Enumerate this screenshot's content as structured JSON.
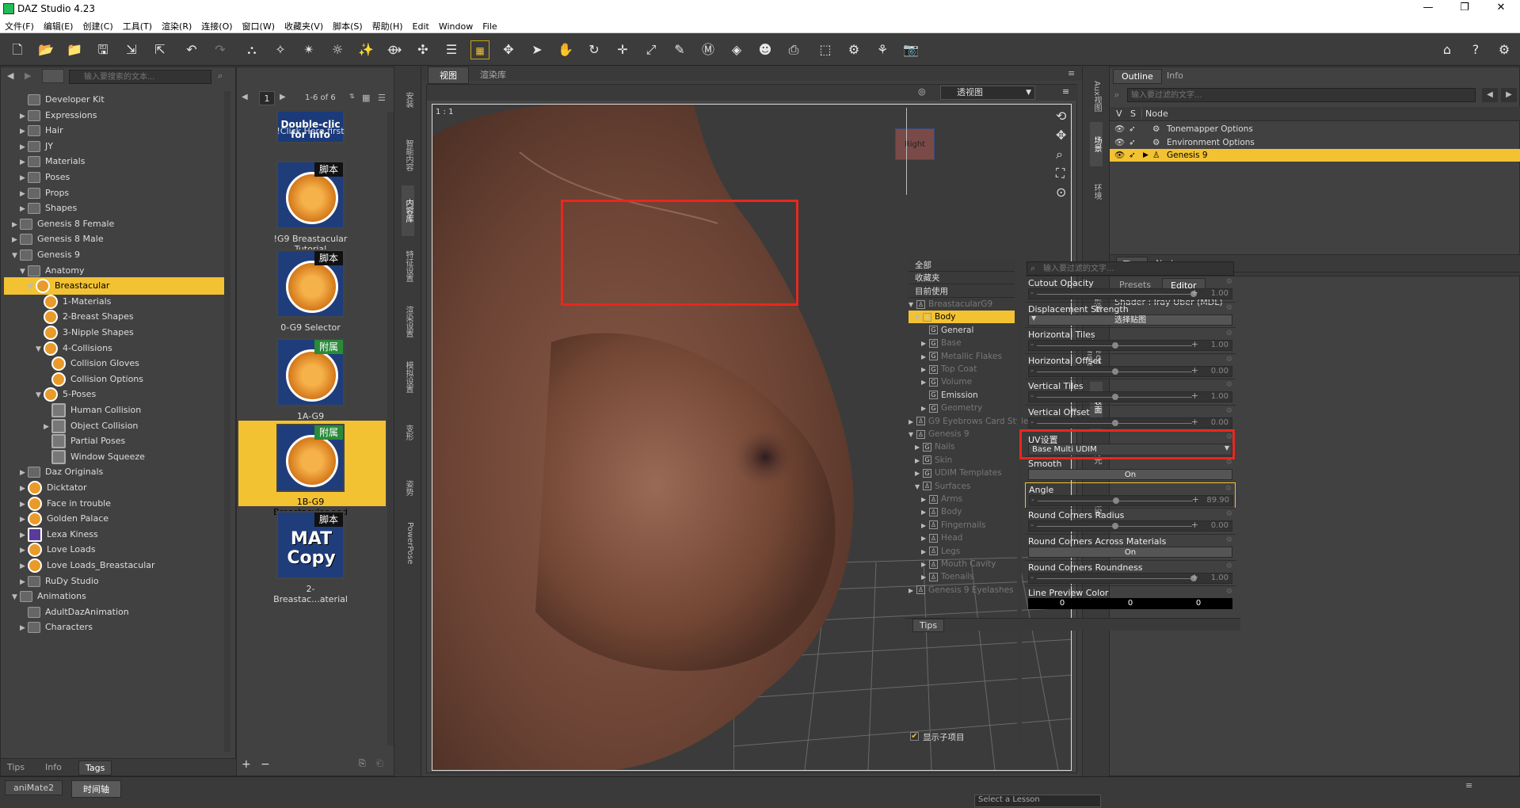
{
  "window": {
    "title": "DAZ Studio 4.23",
    "min": "—",
    "restore": "❐",
    "close": "✕"
  },
  "menu": [
    "文件(F)",
    "编辑(E)",
    "创建(C)",
    "工具(T)",
    "渲染(R)",
    "连接(O)",
    "窗口(W)",
    "收藏夹(V)",
    "脚本(S)",
    "帮助(H)",
    "Edit",
    "Window",
    "File"
  ],
  "content_library": {
    "search_placeholder": "输入要搜索的文本...",
    "tree": [
      {
        "label": "Developer Kit",
        "level": 2,
        "arrow": "",
        "icon": "folder"
      },
      {
        "label": "Expressions",
        "level": 2,
        "arrow": "▶",
        "icon": "folder"
      },
      {
        "label": "Hair",
        "level": 2,
        "arrow": "▶",
        "icon": "folder"
      },
      {
        "label": "JY",
        "level": 2,
        "arrow": "▶",
        "icon": "folder"
      },
      {
        "label": "Materials",
        "level": 2,
        "arrow": "▶",
        "icon": "folder"
      },
      {
        "label": "Poses",
        "level": 2,
        "arrow": "▶",
        "icon": "folder"
      },
      {
        "label": "Props",
        "level": 2,
        "arrow": "▶",
        "icon": "folder"
      },
      {
        "label": "Shapes",
        "level": 2,
        "arrow": "▶",
        "icon": "folder"
      },
      {
        "label": "Genesis 8 Female",
        "level": 1,
        "arrow": "▶",
        "icon": "folder"
      },
      {
        "label": "Genesis 8 Male",
        "level": 1,
        "arrow": "▶",
        "icon": "folder"
      },
      {
        "label": "Genesis 9",
        "level": 1,
        "arrow": "▼",
        "icon": "folder"
      },
      {
        "label": "Anatomy",
        "level": 2,
        "arrow": "▼",
        "icon": "folder"
      },
      {
        "label": "Breastacular",
        "level": 3,
        "arrow": "▼",
        "icon": "orange",
        "selected": true
      },
      {
        "label": "1-Materials",
        "level": 4,
        "arrow": "",
        "icon": "orange"
      },
      {
        "label": "2-Breast Shapes",
        "level": 4,
        "arrow": "",
        "icon": "orange"
      },
      {
        "label": "3-Nipple Shapes",
        "level": 4,
        "arrow": "",
        "icon": "orange"
      },
      {
        "label": "4-Collisions",
        "level": 4,
        "arrow": "▼",
        "icon": "orange"
      },
      {
        "label": "Collision Gloves",
        "level": 5,
        "arrow": "",
        "icon": "orange"
      },
      {
        "label": "Collision Options",
        "level": 5,
        "arrow": "",
        "icon": "orange"
      },
      {
        "label": "5-Poses",
        "level": 4,
        "arrow": "▼",
        "icon": "orange"
      },
      {
        "label": "Human Collision",
        "level": 5,
        "arrow": "",
        "icon": "grey"
      },
      {
        "label": "Object Collision",
        "level": 5,
        "arrow": "▶",
        "icon": "grey"
      },
      {
        "label": "Partial Poses",
        "level": 5,
        "arrow": "",
        "icon": "grey"
      },
      {
        "label": "Window Squeeze",
        "level": 5,
        "arrow": "",
        "icon": "grey"
      },
      {
        "label": "Daz Originals",
        "level": 2,
        "arrow": "▶",
        "icon": "folder"
      },
      {
        "label": "Dicktator",
        "level": 2,
        "arrow": "▶",
        "icon": "orange"
      },
      {
        "label": "Face in trouble",
        "level": 2,
        "arrow": "▶",
        "icon": "orange"
      },
      {
        "label": "Golden Palace",
        "level": 2,
        "arrow": "▶",
        "icon": "orange"
      },
      {
        "label": "Lexa Kiness",
        "level": 2,
        "arrow": "▶",
        "icon": "purple"
      },
      {
        "label": "Love Loads",
        "level": 2,
        "arrow": "▶",
        "icon": "orange"
      },
      {
        "label": "Love Loads_Breastacular",
        "level": 2,
        "arrow": "▶",
        "icon": "orange"
      },
      {
        "label": "RuDy Studio",
        "level": 2,
        "arrow": "▶",
        "icon": "folder"
      },
      {
        "label": "Animations",
        "level": 1,
        "arrow": "▼",
        "icon": "folder"
      },
      {
        "label": "AdultDazAnimation",
        "level": 2,
        "arrow": "",
        "icon": "folder"
      },
      {
        "label": "Characters",
        "level": 2,
        "arrow": "▶",
        "icon": "folder"
      }
    ],
    "bottom_tabs": [
      "Tips",
      "Info",
      "Tags"
    ],
    "active_bottom_tab": "Tags"
  },
  "thumbnails": {
    "page": "1",
    "range": "1-6 of 6",
    "items": [
      {
        "caption": "!Click Here first",
        "tag": "",
        "overlay": "Double-clic for info"
      },
      {
        "caption": "!G9 Breastacular Tutorial",
        "tag": "脚本",
        "overlay": ""
      },
      {
        "caption": "0-G9 Selector",
        "tag": "脚本",
        "overlay": ""
      },
      {
        "caption": "1A-G9 Breastacular Graft",
        "tag": "附属",
        "overlay": ""
      },
      {
        "caption": "1B-G9 Breastacular and Gloves",
        "tag": "附属",
        "overlay": ""
      },
      {
        "caption": "2-Breastac...aterial",
        "tag": "脚本",
        "overlay": "MAT Copy"
      }
    ]
  },
  "left_side_tabs": [
    "安装",
    "智能内容",
    "内容库",
    "特征设置",
    "渲染设置",
    "模拟设置",
    "变形",
    "姿势",
    "PowerPose"
  ],
  "viewport": {
    "tabs": [
      "视图",
      "渲染库"
    ],
    "ratio": "1 : 1",
    "camera": "透视图",
    "cube_label": "Right"
  },
  "right_side_tabs_top": [
    "Aux视图",
    "场景",
    "环境"
  ],
  "right_side_tabs_bottom": [
    "形状",
    "Face Transfer",
    "表面",
    "灯光",
    "渲染"
  ],
  "scene": {
    "tabs": [
      "Outline",
      "Info"
    ],
    "filter_placeholder": "输入要过滤的文字...",
    "headers": {
      "v": "V",
      "s": "S",
      "node": "Node"
    },
    "nodes": [
      {
        "label": "Tonemapper Options",
        "selected": false
      },
      {
        "label": "Environment Options",
        "selected": false
      },
      {
        "label": "Genesis 9",
        "selected": true
      }
    ],
    "bottom_tabs": [
      "Tips",
      "Node"
    ]
  },
  "surfaces": {
    "tabs": [
      "Presets",
      "Editor"
    ],
    "active_tab": "Editor",
    "shader": "Shader : Iray Uber (MDL)",
    "filter_placeholder": "输入要过滤的文字...",
    "groups": [
      "全部",
      "收藏夹",
      "目前使用"
    ],
    "layers": [
      {
        "label": "BreastacularG9",
        "indent": 0,
        "arrow": "▼",
        "dim": true,
        "type": "fig"
      },
      {
        "label": "Body",
        "indent": 1,
        "arrow": "▼",
        "dim": false,
        "type": "fig",
        "selected": true
      },
      {
        "label": "General",
        "indent": 2,
        "arrow": "",
        "dim": false,
        "type": "G"
      },
      {
        "label": "Base",
        "indent": 2,
        "arrow": "▶",
        "dim": true,
        "type": "G"
      },
      {
        "label": "Metallic Flakes",
        "indent": 2,
        "arrow": "▶",
        "dim": true,
        "type": "G"
      },
      {
        "label": "Top Coat",
        "indent": 2,
        "arrow": "▶",
        "dim": true,
        "type": "G"
      },
      {
        "label": "Volume",
        "indent": 2,
        "arrow": "▶",
        "dim": true,
        "type": "G"
      },
      {
        "label": "Emission",
        "indent": 2,
        "arrow": "",
        "dim": false,
        "type": "G"
      },
      {
        "label": "Geometry",
        "indent": 2,
        "arrow": "▶",
        "dim": true,
        "type": "G"
      },
      {
        "label": "G9 Eyebrows Card Style...",
        "indent": 0,
        "arrow": "▶",
        "dim": true,
        "type": "fig"
      },
      {
        "label": "Genesis 9",
        "indent": 0,
        "arrow": "▼",
        "dim": true,
        "type": "fig"
      },
      {
        "label": "Nails",
        "indent": 1,
        "arrow": "▶",
        "dim": true,
        "type": "G"
      },
      {
        "label": "Skin",
        "indent": 1,
        "arrow": "▶",
        "dim": true,
        "type": "G"
      },
      {
        "label": "UDIM Templates",
        "indent": 1,
        "arrow": "▶",
        "dim": true,
        "type": "G"
      },
      {
        "label": "Surfaces",
        "indent": 1,
        "arrow": "▼",
        "dim": true,
        "type": "fig"
      },
      {
        "label": "Arms",
        "indent": 2,
        "arrow": "▶",
        "dim": true,
        "type": "fig"
      },
      {
        "label": "Body",
        "indent": 2,
        "arrow": "▶",
        "dim": true,
        "type": "fig"
      },
      {
        "label": "Fingernails",
        "indent": 2,
        "arrow": "▶",
        "dim": true,
        "type": "fig"
      },
      {
        "label": "Head",
        "indent": 2,
        "arrow": "▶",
        "dim": true,
        "type": "fig"
      },
      {
        "label": "Legs",
        "indent": 2,
        "arrow": "▶",
        "dim": true,
        "type": "fig"
      },
      {
        "label": "Mouth Cavity",
        "indent": 2,
        "arrow": "▶",
        "dim": true,
        "type": "fig"
      },
      {
        "label": "Toenails",
        "indent": 2,
        "arrow": "▶",
        "dim": true,
        "type": "fig"
      },
      {
        "label": "Genesis 9 Eyelashes",
        "indent": 0,
        "arrow": "▶",
        "dim": true,
        "type": "fig"
      }
    ],
    "show_children": "显示子项目",
    "properties": [
      {
        "label": "Cutout Opacity",
        "kind": "slider",
        "value": "1.00",
        "pos": 1.0
      },
      {
        "label": "Displacement Strength",
        "kind": "button",
        "value": "选择贴图"
      },
      {
        "label": "Horizontal Tiles",
        "kind": "slider",
        "value": "1.00",
        "pos": 0.5
      },
      {
        "label": "Horizontal Offset",
        "kind": "slider",
        "value": "0.00",
        "pos": 0.5
      },
      {
        "label": "Vertical Tiles",
        "kind": "slider",
        "value": "1.00",
        "pos": 0.5
      },
      {
        "label": "Vertical Offset",
        "kind": "slider",
        "value": "0.00",
        "pos": 0.5
      },
      {
        "label": "UV设置",
        "kind": "dropdown",
        "value": "Base Multi UDIM"
      },
      {
        "label": "Smooth",
        "kind": "toggle",
        "value": "On"
      },
      {
        "label": "Angle",
        "kind": "slider",
        "value": "89.90",
        "pos": 0.5,
        "highlight": true
      },
      {
        "label": "Round Corners Radius",
        "kind": "slider",
        "value": "0.00",
        "pos": 0.5
      },
      {
        "label": "Round Corners Across Materials",
        "kind": "toggle",
        "value": "On"
      },
      {
        "label": "Round Corners Roundness",
        "kind": "slider",
        "value": "1.00",
        "pos": 1.0
      },
      {
        "label": "Line Preview Color",
        "kind": "color",
        "values": [
          "0",
          "0",
          "0"
        ]
      }
    ],
    "bottom_tab": "Tips"
  },
  "timeline": {
    "tabs": [
      "aniMate2",
      "时间轴"
    ],
    "lesson": "Select a Lesson"
  }
}
